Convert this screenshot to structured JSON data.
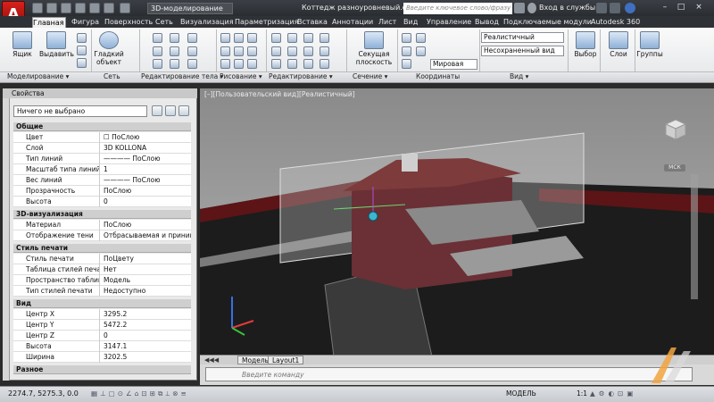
{
  "app": {
    "logo": "A",
    "title": "Коттедж разноуровневый.dwg"
  },
  "workspace": "3D-моделирование",
  "search": {
    "placeholder": "Введите ключевое слово/фразу"
  },
  "login": "Вход в службы",
  "window_controls": [
    "–",
    "□",
    "×"
  ],
  "tabs": [
    "Главная",
    "Фигура",
    "Поверхность",
    "Сеть",
    "Визуализация",
    "Параметризация",
    "Вставка",
    "Аннотации",
    "Лист",
    "Вид",
    "Управление",
    "Вывод",
    "Подключаемые модули",
    "Autodesk 360"
  ],
  "ribbon": {
    "panel_titles": [
      "Моделирование ▾",
      "Сеть",
      "Редактирование тела ▾",
      "Рисование ▾",
      "Редактирование ▾",
      "Сечение ▾",
      "Координаты",
      "Вид ▾"
    ],
    "big_buttons": {
      "box": "Ящик",
      "extrude": "Выдавить",
      "smooth": "Гладкий объект",
      "section": "Секущая плоскость",
      "selection": "Выбор",
      "layers": "Слои",
      "groups": "Группы"
    },
    "combos": {
      "visual_style": "Реалистичный",
      "saved_view": "Несохраненный вид",
      "ucs": "Мировая"
    }
  },
  "properties": {
    "header": "Свойства",
    "selection": "Ничего не выбрано",
    "sections": [
      {
        "title": "Общие",
        "rows": [
          [
            "Цвет",
            "☐ ПоСлою"
          ],
          [
            "Слой",
            "3D KOLLONA"
          ],
          [
            "Тип линий",
            "———— ПоСлою"
          ],
          [
            "Масштаб типа линий",
            "1"
          ],
          [
            "Вес линий",
            "———— ПоСлою"
          ],
          [
            "Прозрачность",
            "ПоСлою"
          ],
          [
            "Высота",
            "0"
          ]
        ]
      },
      {
        "title": "3D-визуализация",
        "rows": [
          [
            "Материал",
            "ПоСлою"
          ],
          [
            "Отображение тени",
            "Отбрасываемая и приним..."
          ]
        ]
      },
      {
        "title": "Стиль печати",
        "rows": [
          [
            "Стиль печати",
            "ПоЦвету"
          ],
          [
            "Таблица стилей печати",
            "Нет"
          ],
          [
            "Пространство таблицы...",
            "Модель"
          ],
          [
            "Тип стилей печати",
            "Недоступно"
          ]
        ]
      },
      {
        "title": "Вид",
        "rows": [
          [
            "Центр X",
            "3295.2"
          ],
          [
            "Центр Y",
            "5472.2"
          ],
          [
            "Центр Z",
            "0"
          ],
          [
            "Высота",
            "3147.1"
          ],
          [
            "Ширина",
            "3202.5"
          ]
        ]
      },
      {
        "title": "Разное",
        "rows": []
      }
    ]
  },
  "viewport": {
    "label": "[–][Пользовательский вид][Реалистичный]",
    "ucs_label": "МСК"
  },
  "layout_tabs": [
    "Модель",
    "Layout1"
  ],
  "command": {
    "placeholder": "Введите команду"
  },
  "status": {
    "coords": "2274.7, 5275.3, 0.0",
    "mode": "МОДЕЛЬ",
    "scale": "1:1"
  },
  "colors": {
    "accent": "#c1141a",
    "ribbon": "#e8e9ec"
  }
}
